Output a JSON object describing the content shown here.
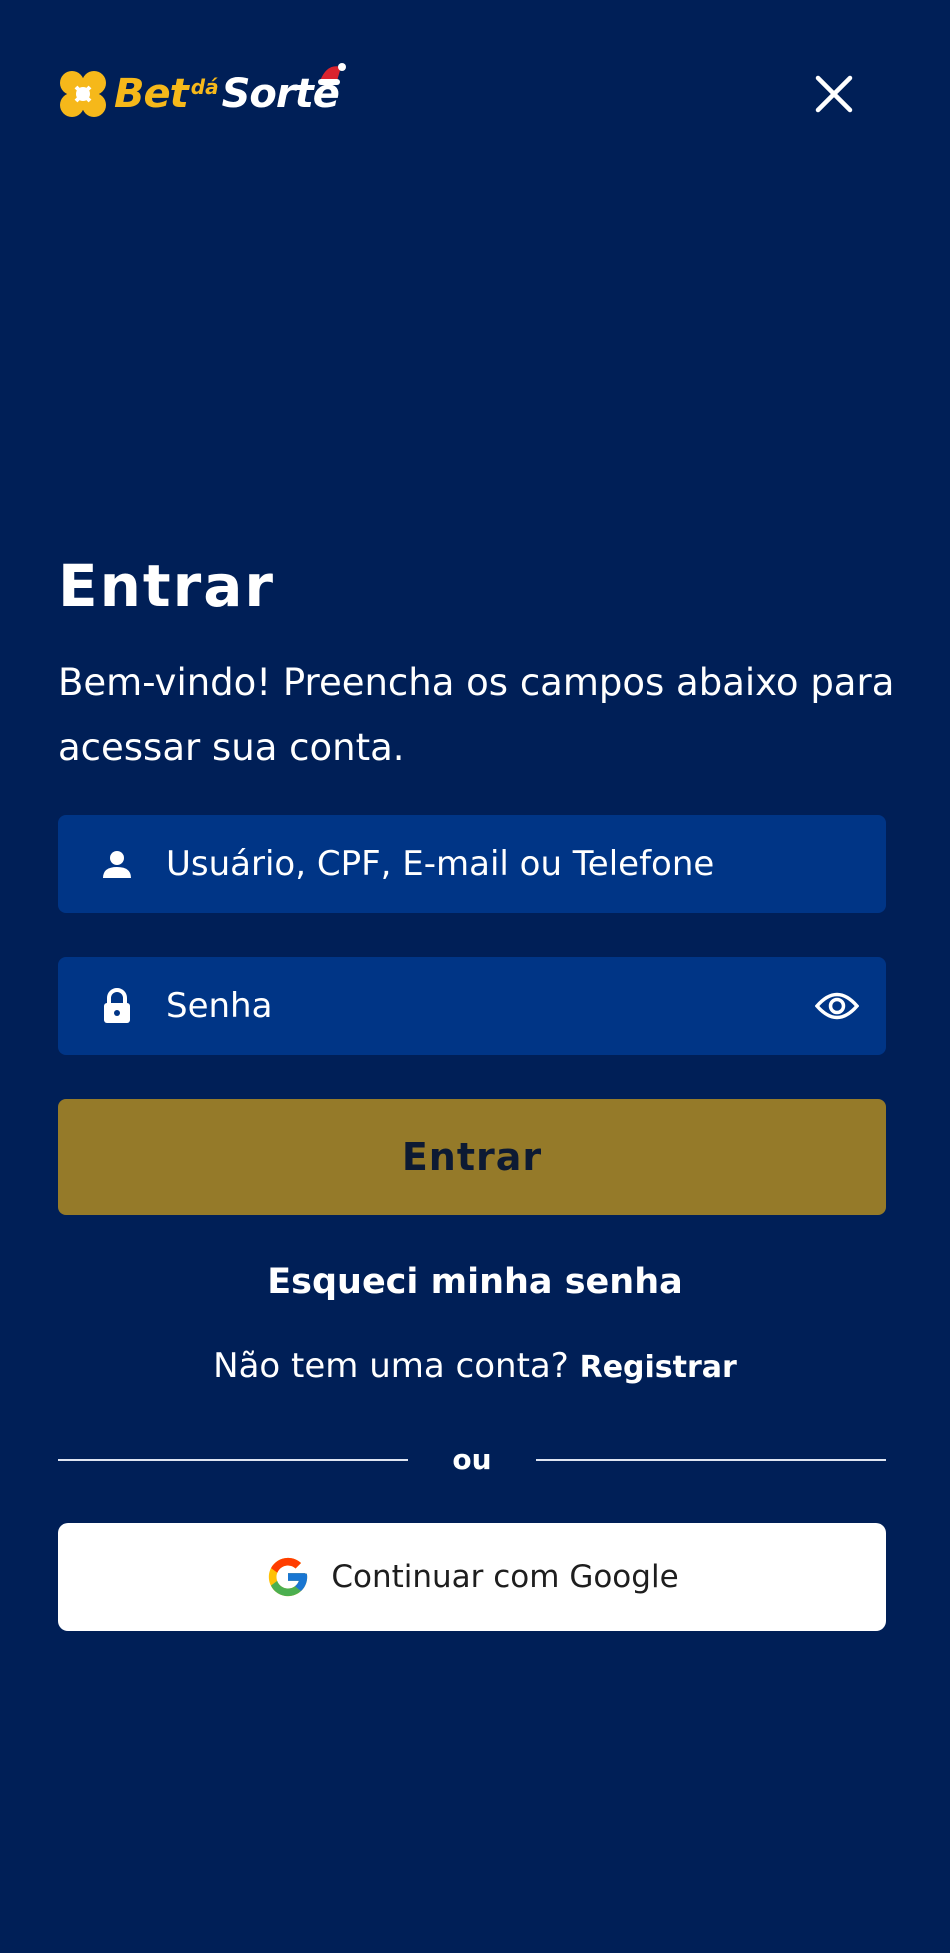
{
  "header": {
    "logo": {
      "part1": "Bet",
      "part2": "dá",
      "part3": "Sorte"
    },
    "close_icon": "close-icon"
  },
  "login": {
    "title": "Entrar",
    "subtitle": "Bem-vindo! Preencha os campos abaixo para acessar sua conta.",
    "username": {
      "placeholder": "Usuário, CPF, E-mail ou Telefone",
      "value": "",
      "icon": "user-icon"
    },
    "password": {
      "placeholder": "Senha",
      "value": "",
      "icon": "lock-icon",
      "toggle_icon": "eye-icon"
    },
    "submit_label": "Entrar",
    "forgot_password": "Esqueci minha senha",
    "no_account": "Não tem uma conta?",
    "register_label": "Registrar",
    "divider_label": "ou",
    "google_label": "Continuar com  Google"
  },
  "colors": {
    "background": "#001f57",
    "field_bg": "#003586",
    "submit_bg": "#957a29",
    "brand_yellow": "#f6b81a",
    "text": "#ffffff"
  }
}
